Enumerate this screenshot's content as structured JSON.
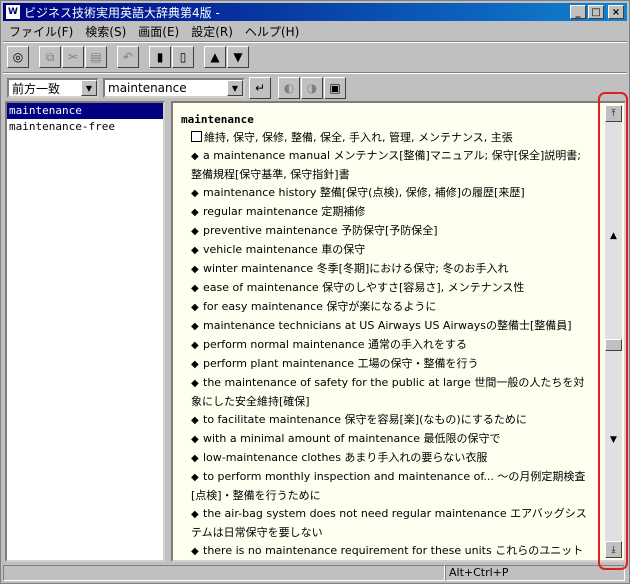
{
  "window": {
    "title": "ビジネス技術実用英語大辞典第4版 -",
    "app_icon": "app-logo-icon",
    "controls": [
      "_",
      "□",
      "×"
    ]
  },
  "menu": [
    "ファイル(F)",
    "検索(S)",
    "画面(E)",
    "設定(R)",
    "ヘルプ(H)"
  ],
  "toolbar": {
    "groups": [
      [
        "disc-icon"
      ],
      [
        "copy-icon",
        "cut-icon",
        "paste-icon"
      ],
      [
        "undo-icon"
      ],
      [
        "book-icon",
        "bookmark-icon"
      ],
      [
        "up-icon",
        "down-icon"
      ]
    ]
  },
  "search": {
    "mode": "前方一致",
    "query": "maintenance",
    "right_buttons": [
      "go-icon",
      "history-back-icon",
      "history-forward-icon",
      "print-icon"
    ]
  },
  "results": [
    "maintenance",
    "maintenance-free"
  ],
  "entry": {
    "headword": "maintenance",
    "meaning": "維持, 保守, 保修, 整備, 保全, 手入れ, 管理, メンテナンス, 主張",
    "examples": [
      "a maintenance manual  メンテナンス[整備]マニュアル; 保守[保全]説明書; 整備規程[保守基準, 保守指針]書",
      "maintenance history  整備[保守(点検), 保修, 補修]の履歴[来歴]",
      "regular maintenance  定期補修",
      "preventive maintenance  予防保守[予防保全]",
      "vehicle maintenance  車の保守",
      "winter maintenance  冬季[冬期]における保守; 冬のお手入れ",
      "ease of maintenance  保守のしやすさ[容易さ], メンテナンス性",
      "for easy maintenance  保守が楽になるように",
      "maintenance technicians at US Airways  US Airwaysの整備士[整備員]",
      "perform normal maintenance  通常の手入れをする",
      "perform plant maintenance  工場の保守・整備を行う",
      "the maintenance of safety for the public at large  世間一般の人たちを対象にした安全維持[確保]",
      "to facilitate maintenance  保守を容易[楽](なもの)にするために",
      "with a minimal amount of maintenance  最低限の保守で",
      "low-maintenance clothes  あまり手入れの要らない衣服",
      "to perform monthly inspection and maintenance of...  ～の月例定期検査[点検]・整備を行うために",
      "the air-bag system does not need regular maintenance  エアバッグシステムは日常保守を要しない",
      "there is no maintenance requirement for these units  これらのユニット"
    ]
  },
  "status": {
    "shortcut": "Alt+Ctrl+P"
  },
  "highlight_color": "#e02020"
}
